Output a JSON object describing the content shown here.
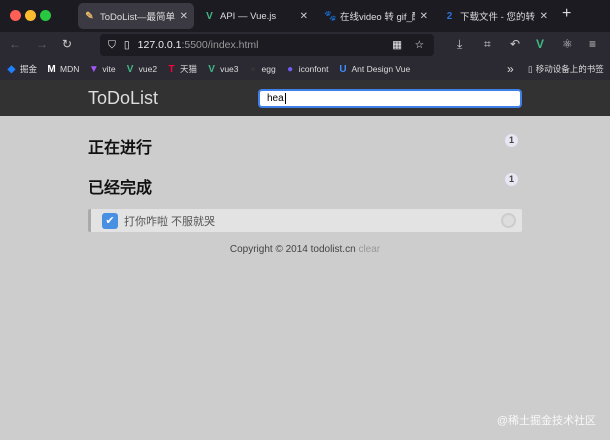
{
  "browser": {
    "tabs": [
      {
        "title": "ToDoList—最简单的待",
        "icon": "pencil-icon",
        "glyph": "✎",
        "color": "#e8b86a",
        "active": true
      },
      {
        "title": "API — Vue.js",
        "icon": "vue-icon",
        "glyph": "V",
        "color": "#42b883"
      },
      {
        "title": "在线video 转 gif_酷",
        "icon": "baidu-icon",
        "glyph": "🐾",
        "color": "#3b5bdb"
      },
      {
        "title": "下载文件 - 您的转换",
        "icon": "convert-icon",
        "glyph": "2",
        "color": "#2f6fd8"
      }
    ],
    "new_tab": "+",
    "url_host": "127.0.0.1",
    "url_rest": ":5500/index.html",
    "bookmarks": [
      {
        "label": "掘金",
        "glyph": "◆",
        "color": "#1e80ff"
      },
      {
        "label": "MDN",
        "glyph": "M",
        "color": "#fff"
      },
      {
        "label": "vite",
        "glyph": "▼",
        "color": "#a259ff"
      },
      {
        "label": "vue2",
        "glyph": "V",
        "color": "#42b883"
      },
      {
        "label": "天猫",
        "glyph": "T",
        "color": "#ff0036"
      },
      {
        "label": "vue3",
        "glyph": "V",
        "color": "#42b883"
      },
      {
        "label": "egg",
        "glyph": "●",
        "color": "#333"
      },
      {
        "label": "iconfont",
        "glyph": "●",
        "color": "#6e5cf5"
      },
      {
        "label": "Ant Design Vue",
        "glyph": "U",
        "color": "#3f8cff"
      }
    ],
    "mobile_bookmarks": "移动设备上的书签"
  },
  "app": {
    "title": "ToDoList",
    "search_value": "hea",
    "sections": [
      {
        "title": "正在进行",
        "count": "1"
      },
      {
        "title": "已经完成",
        "count": "1"
      }
    ],
    "done_items": [
      {
        "text": "打你咋啦 不服就哭",
        "checked": true
      }
    ],
    "footer": "Copyright © 2014 todolist.cn",
    "clear": "clear"
  },
  "watermark": "@稀土掘金技术社区"
}
